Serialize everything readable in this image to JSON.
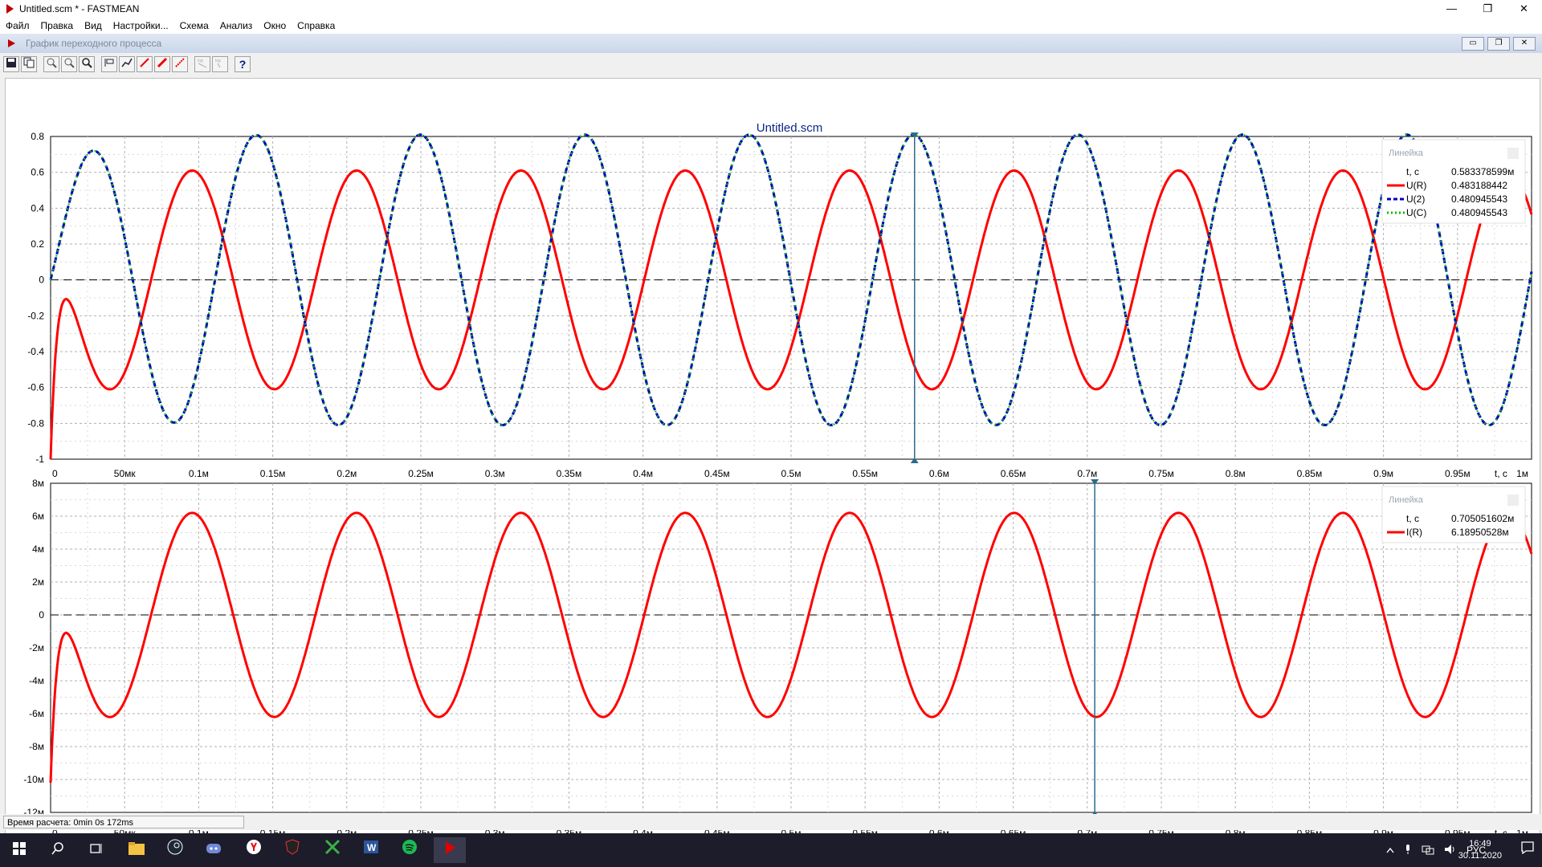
{
  "window": {
    "title": "Untitled.scm * - FASTMEAN",
    "minimize": "—",
    "maximize": "❐",
    "close": "✕"
  },
  "menu": [
    "Файл",
    "Правка",
    "Вид",
    "Настройки...",
    "Схема",
    "Анализ",
    "Окно",
    "Справка"
  ],
  "child": {
    "title": "График переходного процесса",
    "buttons": [
      "▭",
      "❐",
      "✕"
    ]
  },
  "toolbar": {
    "help": "?"
  },
  "plot": {
    "title": "Untitled.scm",
    "x_ticks": [
      "0",
      "50мк",
      "0.1м",
      "0.15м",
      "0.2м",
      "0.25м",
      "0.3м",
      "0.35м",
      "0.4м",
      "0.45м",
      "0.5м",
      "0.55м",
      "0.6м",
      "0.65м",
      "0.7м",
      "0.75м",
      "0.8м",
      "0.85м",
      "0.9м",
      "0.95м",
      "1м"
    ],
    "x_unit": "t, с"
  },
  "chart_data": [
    {
      "type": "line",
      "title": "Untitled.scm",
      "xlabel": "t, с",
      "xlim": [
        0,
        0.001
      ],
      "ylim": [
        -1,
        0.8
      ],
      "y_ticks": [
        "0.8",
        "0.6",
        "0.4",
        "0.2",
        "0",
        "-0.2",
        "-0.4",
        "-0.6",
        "-0.8",
        "-1"
      ],
      "y_tick_values": [
        0.8,
        0.6,
        0.4,
        0.2,
        0,
        -0.2,
        -0.4,
        -0.6,
        -0.8,
        -1
      ],
      "grid": true,
      "series": [
        {
          "name": "U(R)",
          "color": "#ff0000",
          "style": "solid",
          "model": "sine",
          "amplitude": 0.61,
          "period": 0.000111,
          "phase_deg": 140,
          "start": -1.0
        },
        {
          "name": "U(2)",
          "color": "#0000c0",
          "style": "dashed",
          "model": "sine",
          "amplitude": 0.81,
          "period": 0.000111,
          "phase_deg": 0,
          "peak_first": 0.58
        },
        {
          "name": "U(C)",
          "color": "#00c000",
          "style": "dotted",
          "model": "sine",
          "amplitude": 0.81,
          "period": 0.000111,
          "phase_deg": 0,
          "peak_first": 0.58
        }
      ],
      "cursor": {
        "label": "Линейка",
        "t": 0.000583378599,
        "rows": [
          {
            "name": "t, с",
            "value": "0.583378599м",
            "color": ""
          },
          {
            "name": "U(R)",
            "value": "0.483188442",
            "color": "#ff0000",
            "style": "solid"
          },
          {
            "name": "U(2)",
            "value": "0.480945543",
            "color": "#0000c0",
            "style": "dashed"
          },
          {
            "name": "U(C)",
            "value": "0.480945543",
            "color": "#00c000",
            "style": "dotted"
          }
        ]
      }
    },
    {
      "type": "line",
      "xlabel": "t, с",
      "xlim": [
        0,
        0.001
      ],
      "ylim": [
        -0.012,
        0.008
      ],
      "y_ticks": [
        "8м",
        "6м",
        "4м",
        "2м",
        "0",
        "-2м",
        "-4м",
        "-6м",
        "-8м",
        "-10м",
        "-12м"
      ],
      "y_tick_values": [
        0.008,
        0.006,
        0.004,
        0.002,
        0,
        -0.002,
        -0.004,
        -0.006,
        -0.008,
        -0.01,
        -0.012
      ],
      "grid": true,
      "series": [
        {
          "name": "I(R)",
          "color": "#ff0000",
          "style": "solid",
          "model": "sine",
          "amplitude": 0.0062,
          "period": 0.000111,
          "phase_deg": 140,
          "start": -0.0102
        }
      ],
      "cursor": {
        "label": "Линейка",
        "t": 0.000705051602,
        "rows": [
          {
            "name": "t, с",
            "value": "0.705051602м",
            "color": ""
          },
          {
            "name": "I(R)",
            "value": "6.18950528м",
            "color": "#ff0000",
            "style": "solid"
          }
        ]
      }
    }
  ],
  "status": {
    "text": "Время расчета: 0min 0s 172ms"
  },
  "taskbar": {
    "lang": "РУС",
    "time": "16:49",
    "date": "30.11.2020"
  }
}
